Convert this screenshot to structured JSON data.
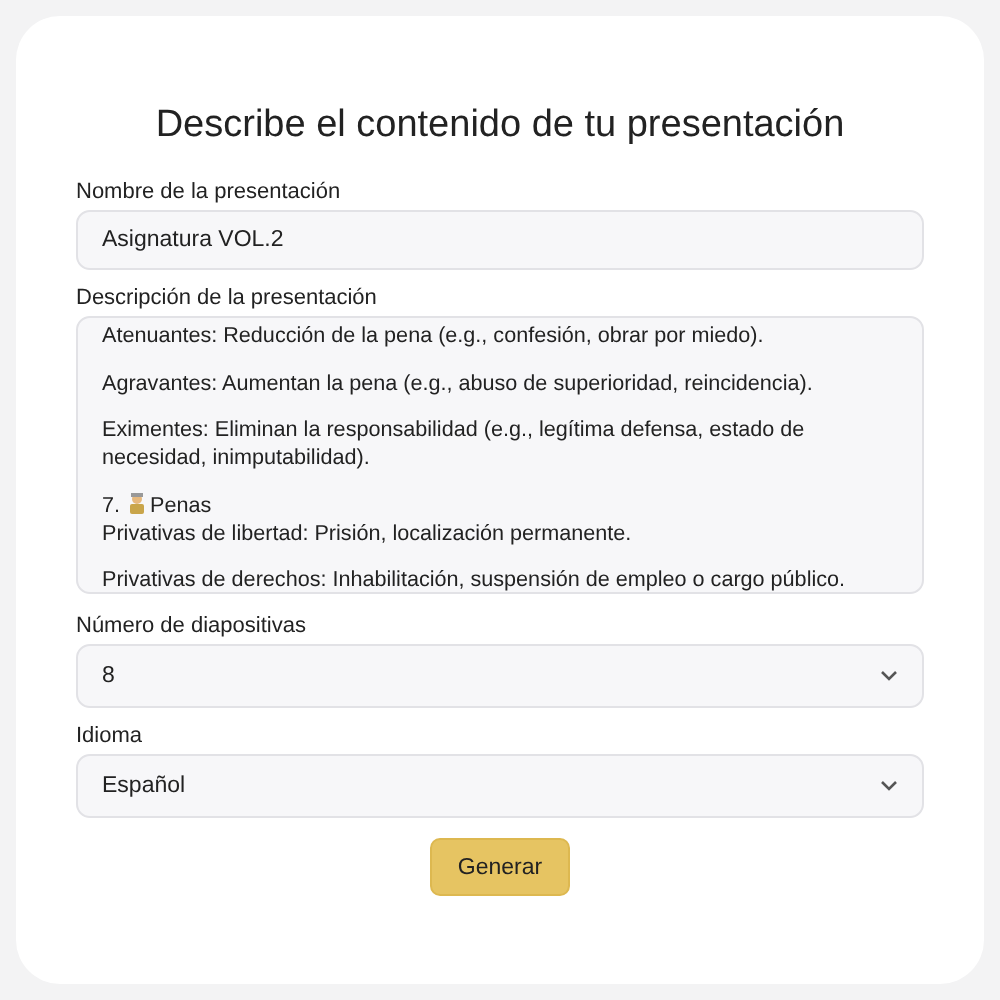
{
  "title": "Describe el contenido de tu presentación",
  "name_field": {
    "label": "Nombre de la presentación",
    "value": "Asignatura VOL.2"
  },
  "description": {
    "label": "Descripción de la presentación",
    "paragraphs": [
      {
        "kind": "text",
        "lines": [
          "Atenuantes: Reducción de la pena (e.g., confesión, obrar por miedo)."
        ]
      },
      {
        "kind": "text",
        "lines": [
          "Agravantes: Aumentan la pena (e.g., abuso de superioridad, reincidencia)."
        ]
      },
      {
        "kind": "text",
        "lines": [
          "Eximentes: Eliminan la responsabilidad (e.g., legítima defensa, estado de necesidad, inimputabilidad)."
        ]
      },
      {
        "kind": "heading",
        "number": "7.",
        "heading": "Penas",
        "lines": [
          "Privativas de libertad: Prisión, localización permanente."
        ]
      },
      {
        "kind": "text",
        "lines": [
          "Privativas de derechos: Inhabilitación, suspensión de empleo o cargo público."
        ]
      }
    ]
  },
  "slides_select": {
    "label": "Número de diapositivas",
    "value": "8"
  },
  "language_select": {
    "label": "Idioma",
    "value": "Español"
  },
  "submit_button": "Generar"
}
